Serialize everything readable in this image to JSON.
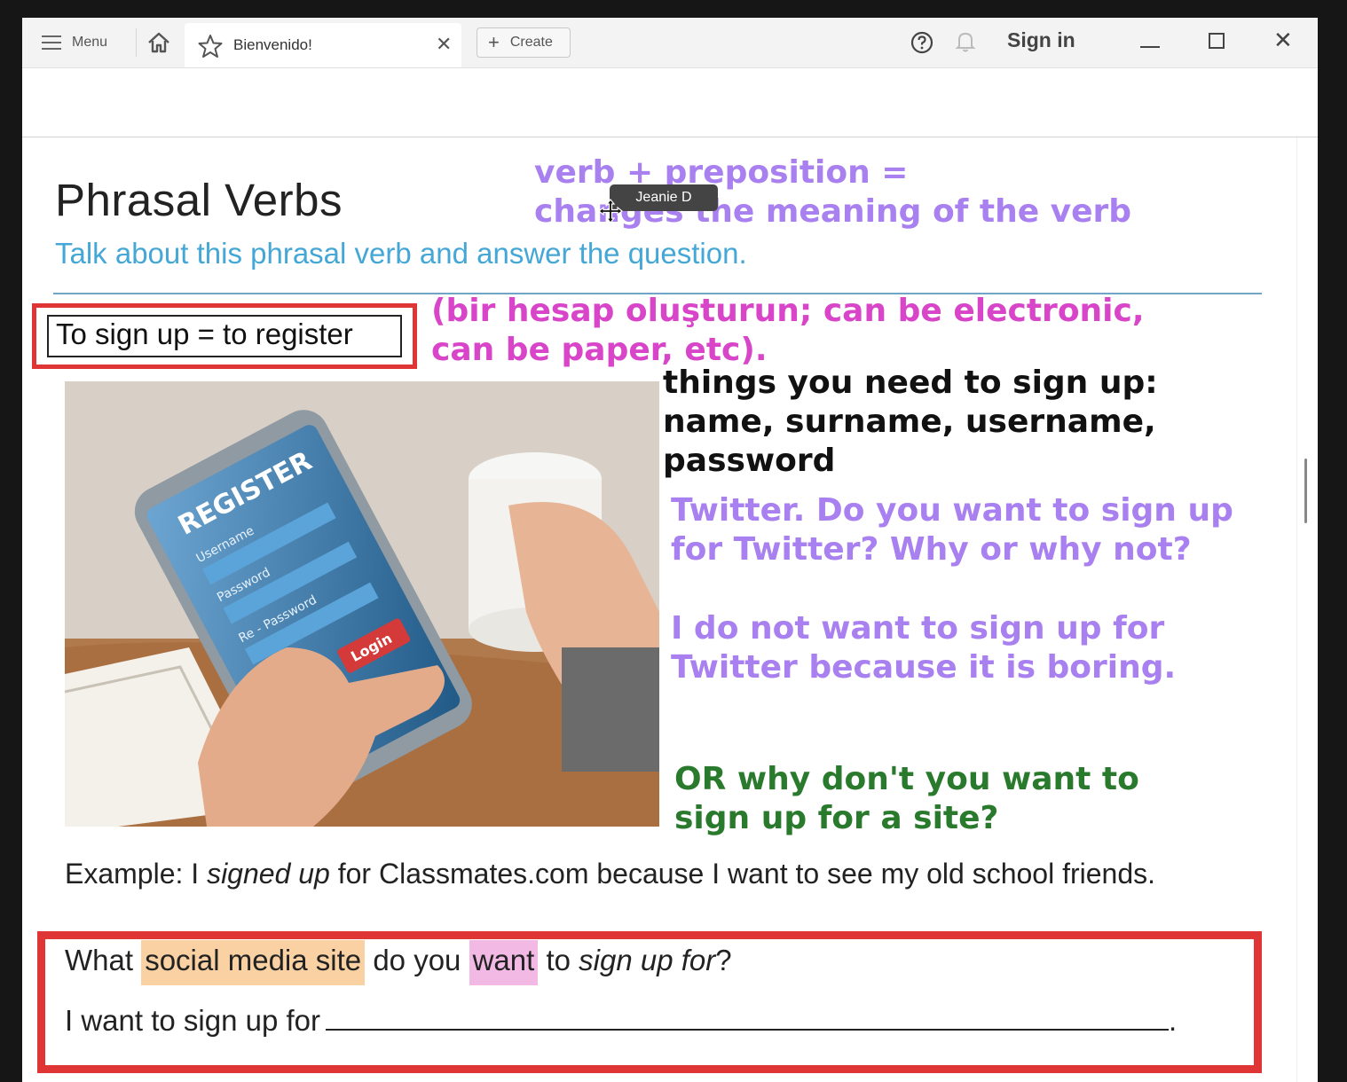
{
  "titlebar": {
    "menu_label": "Menu",
    "tab_title": "Bienvenido!",
    "tab_close": "✕",
    "create_label": "Create",
    "signin_label": "Sign in",
    "close_glyph": "✕"
  },
  "page": {
    "title": "Phrasal Verbs",
    "subtitle": "Talk about this phrasal verb and answer the question.",
    "definition": "To sign up = to register"
  },
  "photo_text": {
    "register": "REGISTER",
    "username": "Username",
    "password": "Password",
    "repassword": "Re - Password",
    "login": "Login"
  },
  "annotations": {
    "verb_line1": "verb + preposition =",
    "verb_line2": "changes the meaning of the verb",
    "turkish_line1": "(bir hesap oluşturun; can be electronic,",
    "turkish_line2": "can be paper, etc).",
    "things_line1": "things you need to sign up:",
    "things_line2": "name, surname, username,",
    "things_line3": "password",
    "twitter_line1": "Twitter. Do you want to sign up",
    "twitter_line2": "for Twitter? Why or why not?",
    "answer_line1": "I do not want to sign up for",
    "answer_line2": "Twitter because it is boring.",
    "or_line1": "OR why don't you want to",
    "or_line2": "sign up for a site?"
  },
  "cursor_tooltip": "Jeanie D",
  "example": {
    "prefix": "Example: I ",
    "italic": "signed up",
    "rest": " for Classmates.com because I want to see my old school friends."
  },
  "question": {
    "what": "What ",
    "social": "social media site",
    "do_you": " do you ",
    "want": "want",
    "to": " to ",
    "sign_up_for": "sign up for",
    "qmark": "?"
  },
  "answer": {
    "prefix": "I want to sign up for",
    "suffix": "."
  },
  "colors": {
    "purple": "#a980ef",
    "magenta": "#d845c9",
    "green": "#2a7a2d",
    "red_box": "#e03535",
    "subtitle_blue": "#45a7d6"
  }
}
